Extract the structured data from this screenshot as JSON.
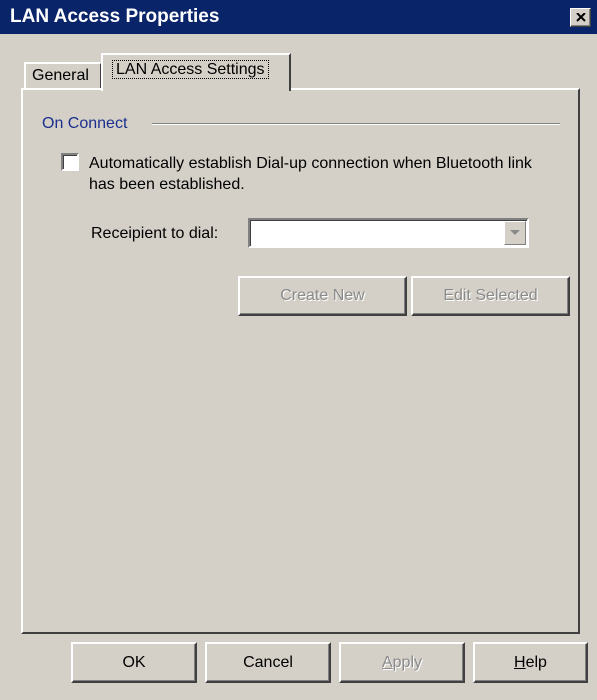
{
  "window": {
    "title": "LAN Access Properties"
  },
  "tabs": [
    {
      "label": "General",
      "selected": false
    },
    {
      "label": "LAN Access Settings",
      "selected": true
    }
  ],
  "on_connect": {
    "section_label": "On Connect",
    "auto_dial_checkbox": {
      "label": "Automatically establish Dial-up connection when Bluetooth link has been established.",
      "checked": false
    },
    "recipient": {
      "label": "Receipient to dial:",
      "value": ""
    },
    "create_new_label": "Create New",
    "edit_selected_label": "Edit Selected"
  },
  "footer": {
    "ok_label": "OK",
    "cancel_label": "Cancel",
    "apply": {
      "prefix": "",
      "accel": "A",
      "rest": "pply"
    },
    "help": {
      "prefix": "",
      "accel": "H",
      "rest": "elp"
    }
  },
  "colors": {
    "titlebar": "#0a246a",
    "face": "#d4d0c8",
    "section_label": "#1a2f8e",
    "disabled_text": "#8a8a8a"
  }
}
